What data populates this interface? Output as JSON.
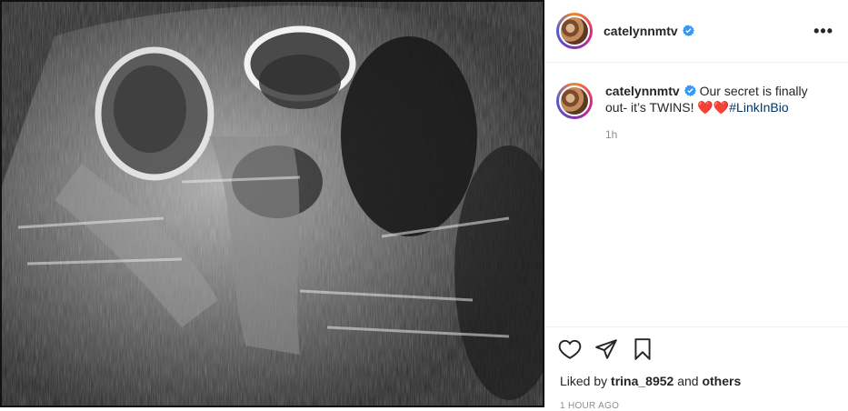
{
  "post": {
    "username": "catelynnmtv",
    "verified": true,
    "more_icon": "more-horizontal-icon",
    "caption": {
      "username": "catelynnmtv",
      "text": "Our secret is finally out- it’s TWINS! ",
      "emoji": "❤️❤️",
      "hashtag": "#LinkInBio",
      "relative_time": "1h"
    },
    "likes": {
      "prefix": "Liked by ",
      "user": "trina_8952",
      "middle": " and ",
      "others": "others"
    },
    "timestamp": "1 HOUR AGO",
    "image": {
      "subject": "ultrasound",
      "colors": {
        "bg": "#2a2a2a",
        "accent": "#f2f2f2"
      }
    },
    "colors": {
      "hashtag": "#00376b",
      "heart": "#e0245e",
      "verified": "#3897f0",
      "muted": "#8e8e8e"
    }
  }
}
